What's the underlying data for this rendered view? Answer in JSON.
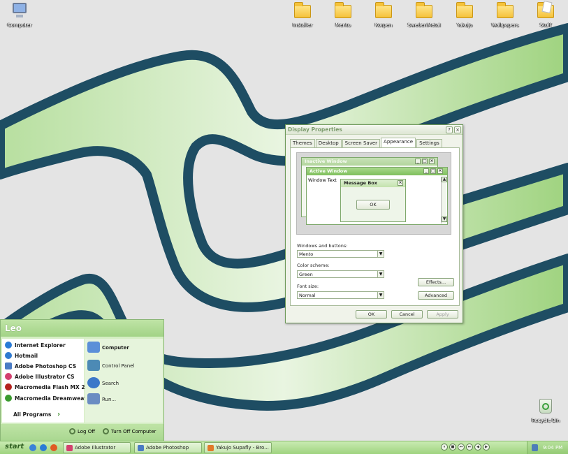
{
  "desktop": {
    "icons_top": [
      {
        "label": "Computer",
        "icon": "computer-icon"
      },
      {
        "label": "Installer",
        "icon": "folder-icon"
      },
      {
        "label": "Mento",
        "icon": "folder-icon"
      },
      {
        "label": "Korpen",
        "icon": "folder-icon"
      },
      {
        "label": "SwedenMetal",
        "icon": "folder-icon"
      },
      {
        "label": "Yakujo",
        "icon": "folder-icon"
      },
      {
        "label": "Wallpapers",
        "icon": "folder-icon"
      },
      {
        "label": "Stuff",
        "icon": "folder-open-icon"
      }
    ],
    "recycle_bin": {
      "label": "Recycle Bin",
      "icon": "recycle-bin-icon"
    }
  },
  "dialog": {
    "title": "Display Properties",
    "help_btn": "?",
    "close_btn": "×",
    "tabs": [
      "Themes",
      "Desktop",
      "Screen Saver",
      "Appearance",
      "Settings"
    ],
    "active_tab": "Appearance",
    "preview": {
      "inactive_title": "Inactive Window",
      "active_title": "Active Window",
      "window_text": "Window Text",
      "message_title": "Message Box",
      "message_ok": "OK",
      "min": "_",
      "max": "□",
      "close": "×",
      "scroll_up": "▲",
      "scroll_down": "▼"
    },
    "windows_buttons_label": "Windows and buttons:",
    "windows_buttons_value": "Mento",
    "color_scheme_label": "Color scheme:",
    "color_scheme_value": "Green",
    "font_size_label": "Font size:",
    "font_size_value": "Normal",
    "dropdown_arrow": "▼",
    "effects_btn": "Effects...",
    "advanced_btn": "Advanced",
    "ok_btn": "OK",
    "cancel_btn": "Cancel",
    "apply_btn": "Apply"
  },
  "start_menu": {
    "user_name": "Leo",
    "pinned": [
      {
        "label": "Internet Explorer",
        "color": "#2a7bd6"
      },
      {
        "label": "Hotmail",
        "color": "#2f7ad0"
      },
      {
        "label": "Adobe Photoshop CS",
        "color": "#4a7bc4"
      },
      {
        "label": "Adobe Illustrator CS",
        "color": "#d3406e"
      },
      {
        "label": "Macromedia Flash MX 2004",
        "color": "#b4231e"
      },
      {
        "label": "Macromedia Dreamweav...",
        "color": "#3a9a2f"
      }
    ],
    "all_programs": "All Programs",
    "all_programs_arrow": "›",
    "places": [
      {
        "label": "Computer",
        "color": "#5b8fd8"
      },
      {
        "label": "Control Panel",
        "color": "#4c8ab5"
      },
      {
        "label": "Search",
        "color": "#3c78c9"
      },
      {
        "label": "Run...",
        "color": "#6b8cc2"
      }
    ],
    "log_off": "Log Off",
    "turn_off": "Turn Off Computer"
  },
  "taskbar": {
    "start_label": "start",
    "tasks": [
      {
        "label": "Adobe Illustrator",
        "color": "#d3406e"
      },
      {
        "label": "Adobe Photoshop",
        "color": "#4a7bc4"
      },
      {
        "label": "Yakujo Supafly - Bro...",
        "color": "#e27a2a"
      }
    ],
    "media_controls": [
      "⏸",
      "■",
      "⏮",
      "⏭",
      "◀",
      "▶"
    ],
    "clock": "9:04 PM"
  },
  "colors": {
    "accent_green": "#9fd37f",
    "wallpaper_stripe": "#1e4d63",
    "wallpaper_fill": "#a8d58e"
  }
}
